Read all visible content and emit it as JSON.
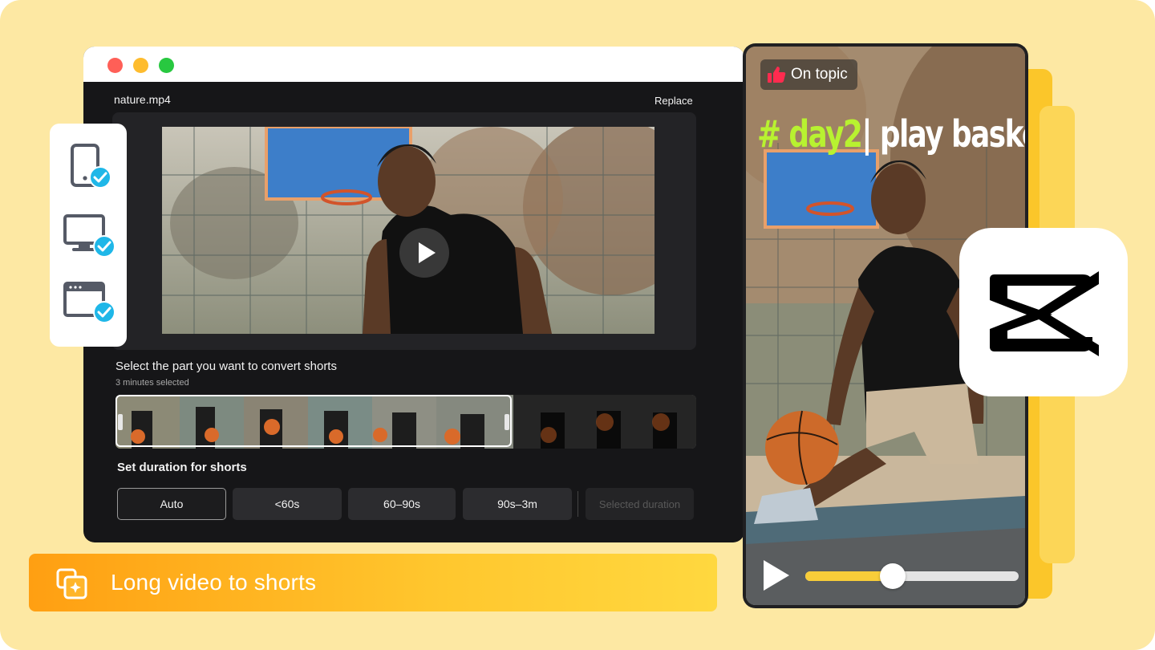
{
  "window": {
    "traffic_lights": {
      "close_color": "#ff5f57",
      "minimize_color": "#febc2e",
      "zoom_color": "#28c840"
    },
    "filename": "nature.mp4",
    "replace_label": "Replace"
  },
  "selection": {
    "title": "Select the part you want to convert shorts",
    "subtitle": "3 minutes selected"
  },
  "duration": {
    "title": "Set duration for shorts",
    "options": [
      "Auto",
      "<60s",
      "60–90s",
      "90s–3m"
    ],
    "selected_option": "Auto",
    "custom_placeholder": "Selected duration"
  },
  "devices": {
    "items": [
      {
        "icon": "tablet-icon",
        "checked": true
      },
      {
        "icon": "desktop-icon",
        "checked": true
      },
      {
        "icon": "browser-window-icon",
        "checked": true
      }
    ],
    "check_color": "#1fb7e8"
  },
  "banner": {
    "icon": "sparkle-copy-icon",
    "text": "Long video to shorts"
  },
  "phone": {
    "badge_icon": "thumbs-up-icon",
    "badge_text": "On topic",
    "caption_hash": "# day2",
    "caption_rest": "| play basketball",
    "progress": 0.41
  },
  "colors": {
    "background": "#fde8a3",
    "accent_yellow": "#f8cd39",
    "caption_green": "#b8f230"
  }
}
